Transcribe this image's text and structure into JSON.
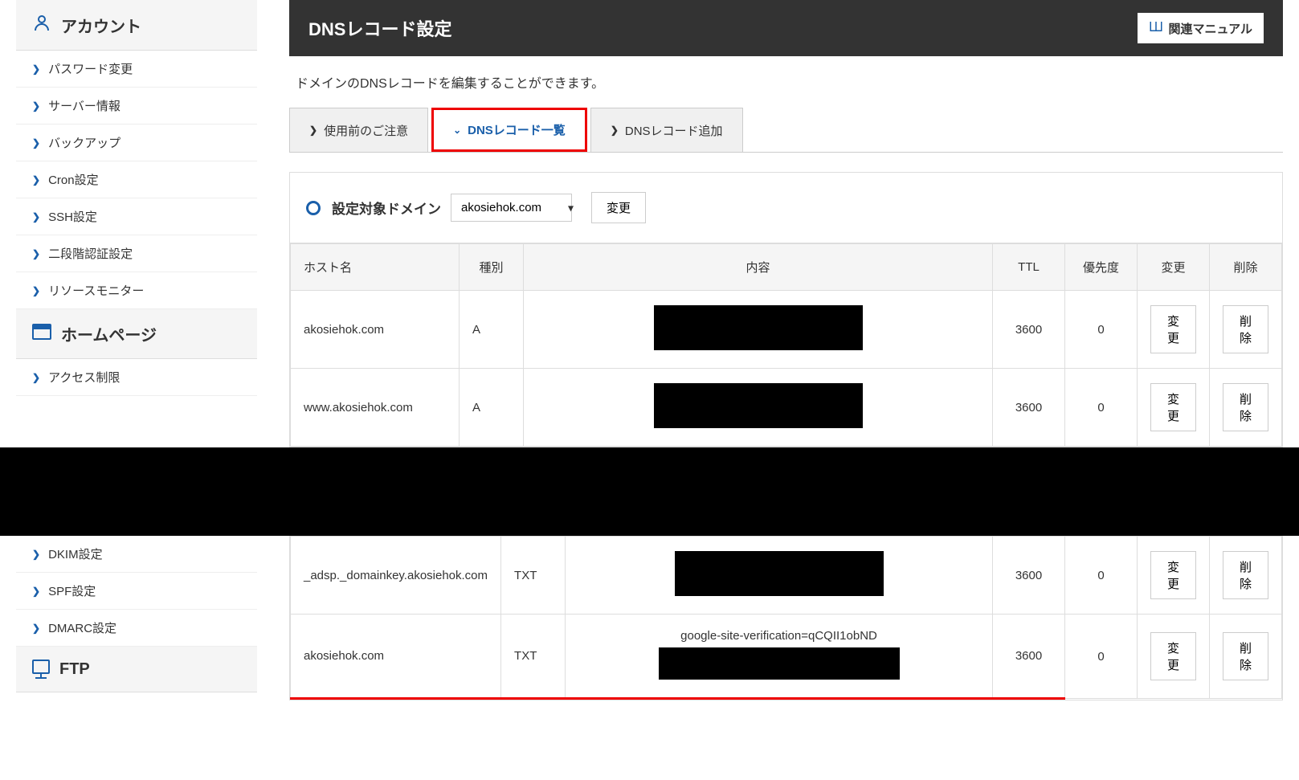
{
  "sidebar": {
    "sections": [
      {
        "header": "アカウント",
        "icon": "person",
        "items": [
          "パスワード変更",
          "サーバー情報",
          "バックアップ",
          "Cron設定",
          "SSH設定",
          "二段階認証設定",
          "リソースモニター"
        ]
      },
      {
        "header": "ホームページ",
        "icon": "window",
        "items": [
          "アクセス制限"
        ]
      },
      {
        "header": null,
        "items": [
          "DKIM設定",
          "SPF設定",
          "DMARC設定"
        ]
      },
      {
        "header": "FTP",
        "icon": "monitor",
        "items": []
      }
    ]
  },
  "header": {
    "title": "DNSレコード設定",
    "manual_btn_label": "関連マニュアル"
  },
  "description": "ドメインのDNSレコードを編集することができます。",
  "tabs": [
    {
      "label": "使用前のご注意",
      "active": false
    },
    {
      "label": "DNSレコード一覧",
      "active": true
    },
    {
      "label": "DNSレコード追加",
      "active": false
    }
  ],
  "domain": {
    "label": "設定対象ドメイン",
    "selected": "akosiehok.com",
    "change_btn": "変更"
  },
  "table": {
    "headers": {
      "host": "ホスト名",
      "type": "種別",
      "content": "内容",
      "ttl": "TTL",
      "priority": "優先度",
      "edit": "変更",
      "delete": "削除"
    },
    "rows": [
      {
        "host": "akosiehok.com",
        "type": "A",
        "content": "",
        "content_redacted": true,
        "ttl": "3600",
        "priority": "0"
      },
      {
        "host": "www.akosiehok.com",
        "type": "A",
        "content": "",
        "content_redacted": true,
        "ttl": "3600",
        "priority": "0"
      },
      {
        "host": "_adsp._domainkey.akosiehok.com",
        "type": "TXT",
        "content": "",
        "content_redacted": true,
        "ttl": "3600",
        "priority": "0"
      },
      {
        "host": "akosiehok.com",
        "type": "TXT",
        "content": "google-site-verification=qCQII1obND",
        "content_redacted": true,
        "ttl": "3600",
        "priority": "0",
        "highlighted": true
      }
    ],
    "edit_btn": "変更",
    "delete_btn": "削除"
  }
}
